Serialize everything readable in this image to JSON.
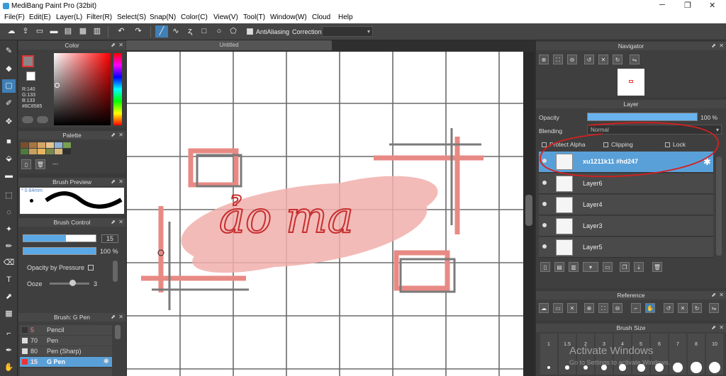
{
  "app": {
    "title": "MediBang Paint Pro (32bit)"
  },
  "menu": [
    "File(F)",
    "Edit(E)",
    "Layer(L)",
    "Filter(R)",
    "Select(S)",
    "Snap(N)",
    "Color(C)",
    "View(V)",
    "Tool(T)",
    "Window(W)",
    "Cloud",
    "Help"
  ],
  "toolbar": {
    "antialiasing_label": "AntiAliasing",
    "correction_label": "Correction",
    "correction_value": ""
  },
  "canvas": {
    "tab_title": "Untitled",
    "handwriting": "ảo ma",
    "page_color": "#ffffff",
    "grid_color": "#6a6a6a",
    "stroke_color": "#e88a84",
    "box_color": "#7a7a7a"
  },
  "color_panel": {
    "title": "Color",
    "readout": [
      "R:140",
      "G:133",
      "B:133",
      "#8C8585"
    ]
  },
  "palette_panel": {
    "title": "Palette",
    "swatches": [
      "#7a4f2a",
      "#a57543",
      "#d5a567",
      "#e6c48d",
      "#8fb4d6",
      "#78a050",
      "#507a3c",
      "#c8a060",
      "#e5b560",
      "#7a8a4c",
      "#d7b87a",
      "#2f2f2f"
    ],
    "more_label": "---"
  },
  "brush_preview": {
    "title": "Brush Preview",
    "size_label": "* 0.64mm"
  },
  "brush_control": {
    "title": "Brush Control",
    "size_value": "15",
    "opacity_value": "100 %",
    "opacity_by_pressure": "Opacity by Pressure",
    "ooze_label": "Ooze",
    "ooze_value": "3"
  },
  "brush_list": {
    "title": "Brush: G Pen",
    "items": [
      {
        "size": "5",
        "name": "Pencil"
      },
      {
        "size": "70",
        "name": "Pen"
      },
      {
        "size": "80",
        "name": "Pen (Sharp)"
      },
      {
        "size": "15",
        "name": "G Pen"
      }
    ]
  },
  "navigator": {
    "title": "Navigator"
  },
  "layer_panel": {
    "title": "Layer",
    "opacity_label": "Opacity",
    "opacity_value": "100 %",
    "opacity_fraction": 1.0,
    "blending_label": "Blending",
    "blending_value": "Normal",
    "protect_alpha": "Protect Alpha",
    "clipping": "Clipping",
    "lock": "Lock",
    "layers": [
      "xu1211k11 #hd247",
      "Layer6",
      "Layer4",
      "Layer3",
      "Layer5"
    ]
  },
  "reference": {
    "title": "Reference"
  },
  "brush_size": {
    "title": "Brush Size",
    "labels": [
      "1",
      "1.5",
      "2",
      "3",
      "4",
      "5",
      "6",
      "7",
      "8",
      "10"
    ]
  },
  "watermark": {
    "line1": "Activate Windows",
    "line2": "Go to Settings to activate Windows."
  },
  "colors": {
    "accent": "#3f7fb6",
    "selection_red": "#d42020"
  }
}
